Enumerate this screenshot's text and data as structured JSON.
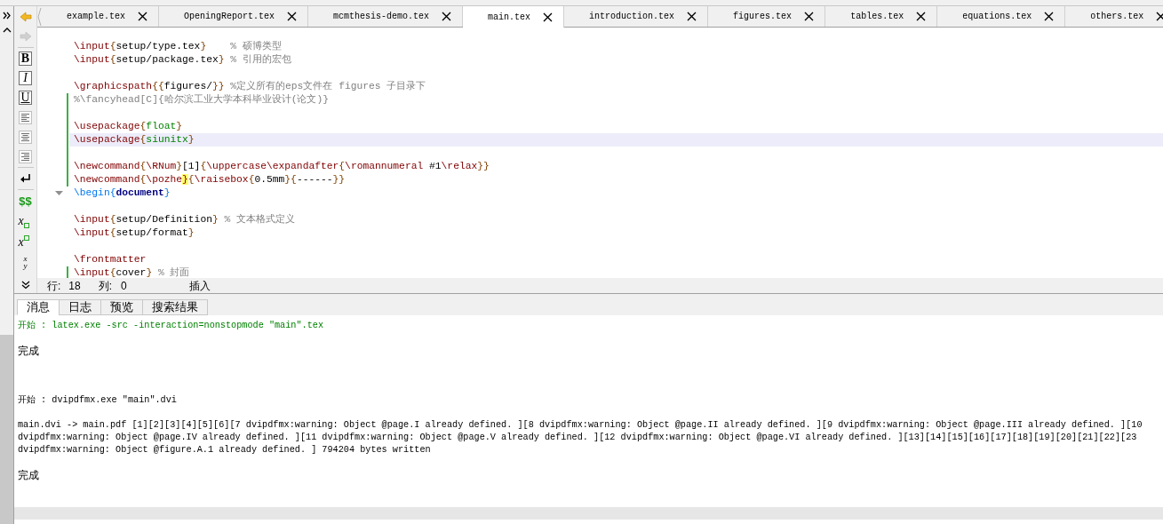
{
  "toolbar": {
    "items": [
      {
        "kind": "back",
        "disabled": false
      },
      {
        "kind": "forward",
        "disabled": true
      },
      {
        "kind": "bold",
        "label": "B"
      },
      {
        "kind": "italic",
        "label": "I"
      },
      {
        "kind": "underline",
        "label": "U"
      },
      {
        "kind": "align-left"
      },
      {
        "kind": "align-center"
      },
      {
        "kind": "align-right"
      },
      {
        "kind": "newline"
      },
      {
        "kind": "math",
        "label": "$$"
      },
      {
        "kind": "subscript",
        "label": "x"
      },
      {
        "kind": "superscript",
        "label": "x"
      },
      {
        "kind": "fraction",
        "label": "x",
        "label2": "y"
      },
      {
        "kind": "more"
      }
    ]
  },
  "tabs": [
    {
      "label": "example.tex",
      "selected": false
    },
    {
      "label": "OpeningReport.tex",
      "selected": false
    },
    {
      "label": "mcmthesis-demo.tex",
      "selected": false
    },
    {
      "label": "main.tex",
      "selected": true
    },
    {
      "label": "introduction.tex",
      "selected": false
    },
    {
      "label": "figures.tex",
      "selected": false
    },
    {
      "label": "tables.tex",
      "selected": false
    },
    {
      "label": "equations.tex",
      "selected": false
    },
    {
      "label": "others.tex",
      "selected": false
    }
  ],
  "editor": {
    "lines": [
      {
        "changed": false,
        "current": false,
        "fold": false,
        "tokens": [
          {
            "kind": "cmd",
            "text": "\\input"
          },
          {
            "kind": "brace",
            "text": "{"
          },
          {
            "kind": "plain",
            "text": "setup/type.tex"
          },
          {
            "kind": "brace",
            "text": "}    "
          },
          {
            "kind": "comment",
            "text": "% 硕博类型"
          }
        ]
      },
      {
        "changed": false,
        "current": false,
        "fold": false,
        "tokens": [
          {
            "kind": "cmd",
            "text": "\\input"
          },
          {
            "kind": "brace",
            "text": "{"
          },
          {
            "kind": "plain",
            "text": "setup/package.tex"
          },
          {
            "kind": "brace",
            "text": "} "
          },
          {
            "kind": "comment",
            "text": "% 引用的宏包"
          }
        ]
      },
      {
        "changed": false,
        "current": false,
        "fold": false
      },
      {
        "changed": false,
        "current": false,
        "fold": false,
        "tokens": [
          {
            "kind": "cmd",
            "text": "\\graphicspath"
          },
          {
            "kind": "brace",
            "text": "{{"
          },
          {
            "kind": "plain",
            "text": "figures/"
          },
          {
            "kind": "brace",
            "text": "}} "
          },
          {
            "kind": "comment",
            "text": "%定义所有的eps文件在 figures 子目录下"
          }
        ]
      },
      {
        "changed": true,
        "current": false,
        "fold": false,
        "tokens": [
          {
            "kind": "comment",
            "text": "%\\fancyhead[C]{哈尔滨工业大学本科毕业设计(论文)}"
          }
        ]
      },
      {
        "changed": true,
        "current": false,
        "fold": false
      },
      {
        "changed": true,
        "current": false,
        "fold": false,
        "tokens": [
          {
            "kind": "cmd",
            "text": "\\usepackage"
          },
          {
            "kind": "brace",
            "text": "{"
          },
          {
            "kind": "package",
            "text": "float"
          },
          {
            "kind": "brace",
            "text": "}"
          }
        ]
      },
      {
        "changed": true,
        "current": true,
        "fold": false,
        "tokens": [
          {
            "kind": "cmd",
            "text": "\\usepackage"
          },
          {
            "kind": "brace",
            "text": "{"
          },
          {
            "kind": "package",
            "text": "siunitx"
          },
          {
            "kind": "brace",
            "text": "}"
          }
        ]
      },
      {
        "changed": true,
        "current": false,
        "fold": false
      },
      {
        "changed": true,
        "current": false,
        "fold": false,
        "tokens": [
          {
            "kind": "cmd",
            "text": "\\newcommand"
          },
          {
            "kind": "brace",
            "text": "{"
          },
          {
            "kind": "cmd",
            "text": "\\RNum"
          },
          {
            "kind": "brace",
            "text": "}"
          },
          {
            "kind": "plain",
            "text": "[1]"
          },
          {
            "kind": "brace",
            "text": "{"
          },
          {
            "kind": "cmd",
            "text": "\\uppercase\\expandafter"
          },
          {
            "kind": "brace",
            "text": "{"
          },
          {
            "kind": "cmd",
            "text": "\\romannumeral"
          },
          {
            "kind": "plain",
            "text": " #1"
          },
          {
            "kind": "cmd",
            "text": "\\relax"
          },
          {
            "kind": "brace",
            "text": "}}"
          }
        ]
      },
      {
        "changed": true,
        "current": false,
        "fold": false,
        "tokens": [
          {
            "kind": "cmd",
            "text": "\\newcommand"
          },
          {
            "kind": "brace",
            "text": "{"
          },
          {
            "kind": "cmd",
            "text": "\\pozhe"
          },
          {
            "kind": "match",
            "text": "}"
          },
          {
            "kind": "brace",
            "text": "{"
          },
          {
            "kind": "cmd",
            "text": "\\raisebox"
          },
          {
            "kind": "brace",
            "text": "{"
          },
          {
            "kind": "plain",
            "text": "0.5mm"
          },
          {
            "kind": "brace",
            "text": "}{"
          },
          {
            "kind": "plain",
            "text": "------"
          },
          {
            "kind": "brace",
            "text": "}}"
          }
        ]
      },
      {
        "changed": false,
        "current": false,
        "fold": true,
        "tokens": [
          {
            "kind": "env_cmd",
            "text": "\\begin"
          },
          {
            "kind": "env_brace",
            "text": "{"
          },
          {
            "kind": "env_name",
            "text": "document"
          },
          {
            "kind": "env_brace",
            "text": "}"
          }
        ]
      },
      {
        "changed": false,
        "current": false,
        "fold": false
      },
      {
        "changed": false,
        "current": false,
        "fold": false,
        "tokens": [
          {
            "kind": "cmd",
            "text": "\\input"
          },
          {
            "kind": "brace",
            "text": "{"
          },
          {
            "kind": "plain",
            "text": "setup/Definition"
          },
          {
            "kind": "brace",
            "text": "} "
          },
          {
            "kind": "comment",
            "text": "% 文本格式定义"
          }
        ]
      },
      {
        "changed": false,
        "current": false,
        "fold": false,
        "tokens": [
          {
            "kind": "cmd",
            "text": "\\input"
          },
          {
            "kind": "brace",
            "text": "{"
          },
          {
            "kind": "plain",
            "text": "setup/format"
          },
          {
            "kind": "brace",
            "text": "}"
          }
        ]
      },
      {
        "changed": false,
        "current": false,
        "fold": false
      },
      {
        "changed": false,
        "current": false,
        "fold": false,
        "tokens": [
          {
            "kind": "cmd",
            "text": "\\frontmatter"
          }
        ]
      },
      {
        "changed": true,
        "current": false,
        "fold": false,
        "tokens": [
          {
            "kind": "cmd",
            "text": "\\input"
          },
          {
            "kind": "brace",
            "text": "{"
          },
          {
            "kind": "plain",
            "text": "cover"
          },
          {
            "kind": "brace",
            "text": "} "
          },
          {
            "kind": "comment",
            "text": "% 封面"
          }
        ]
      }
    ]
  },
  "status_bar": {
    "line_label": "行:",
    "line": "18",
    "column_label": "列:",
    "column": "0",
    "mode": "插入"
  },
  "output": {
    "tabs": [
      {
        "label": "消息",
        "selected": true
      },
      {
        "label": "日志",
        "selected": false
      },
      {
        "label": "预览",
        "selected": false
      },
      {
        "label": "搜索结果",
        "selected": false
      }
    ],
    "runs": [
      {
        "command": "开始 : latex.exe -src -interaction=nonstopmode \"main\".tex",
        "highlighted": true,
        "result": "完成"
      },
      {
        "command": "开始 : dvipdfmx.exe \"main\".dvi",
        "highlighted": false,
        "log": "main.dvi -> main.pdf [1][2][3][4][5][6][7 dvipdfmx:warning: Object @page.I already defined. ][8 dvipdfmx:warning: Object @page.II already defined. ][9 dvipdfmx:warning: Object @page.III already defined. ][10 dvipdfmx:warning: Object @page.IV already defined. ][11 dvipdfmx:warning: Object @page.V already defined. ][12 dvipdfmx:warning: Object @page.VI already defined. ][13][14][15][16][17][18][19][20][21][22][23 dvipdfmx:warning: Object @figure.A.1 already defined. ] 794204 bytes written",
        "result": "完成"
      }
    ]
  }
}
